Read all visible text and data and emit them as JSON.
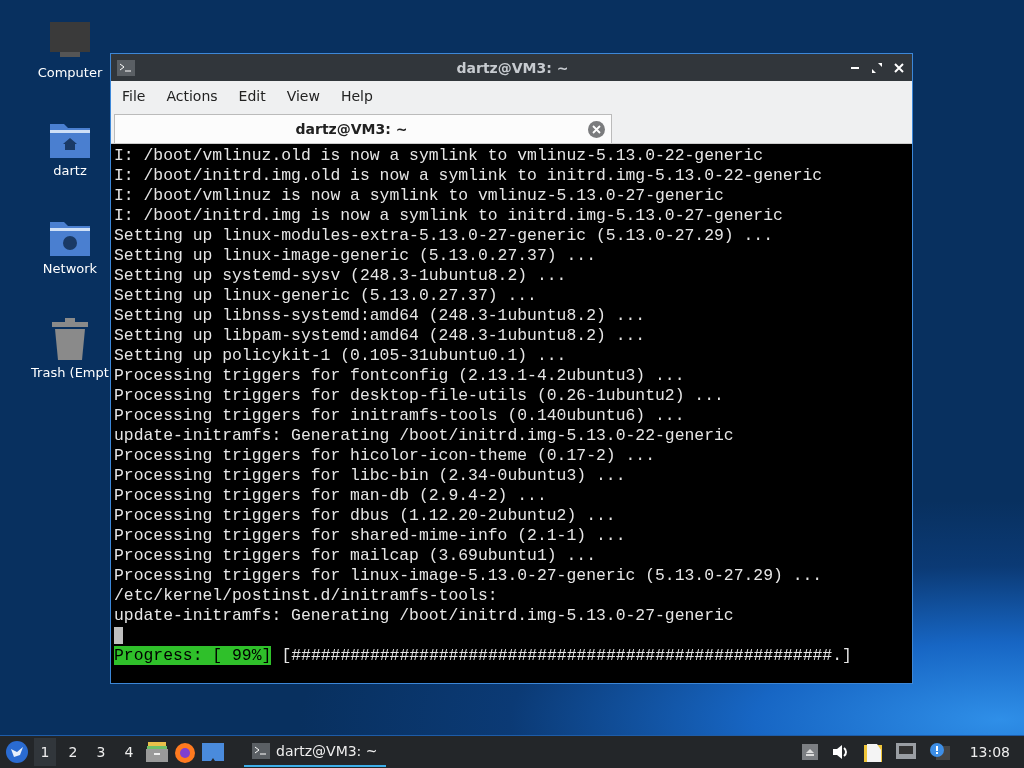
{
  "desktop_icons": [
    {
      "label": "Computer",
      "kind": "computer"
    },
    {
      "label": "dartz",
      "kind": "home"
    },
    {
      "label": "Network",
      "kind": "network"
    },
    {
      "label": "Trash (Empt",
      "kind": "trash"
    }
  ],
  "window": {
    "title": "dartz@VM3: ~",
    "menu": [
      "File",
      "Actions",
      "Edit",
      "View",
      "Help"
    ],
    "tabs": [
      {
        "label": "dartz@VM3: ~",
        "selected": true
      }
    ],
    "terminal": {
      "lines": [
        {
          "kind": "text",
          "text": "I: /boot/vmlinuz.old is now a symlink to vmlinuz-5.13.0-22-generic"
        },
        {
          "kind": "text",
          "text": "I: /boot/initrd.img.old is now a symlink to initrd.img-5.13.0-22-generic"
        },
        {
          "kind": "text",
          "text": "I: /boot/vmlinuz is now a symlink to vmlinuz-5.13.0-27-generic"
        },
        {
          "kind": "text",
          "text": "I: /boot/initrd.img is now a symlink to initrd.img-5.13.0-27-generic"
        },
        {
          "kind": "text",
          "text": "Setting up linux-modules-extra-5.13.0-27-generic (5.13.0-27.29) ..."
        },
        {
          "kind": "text",
          "text": "Setting up linux-image-generic (5.13.0.27.37) ..."
        },
        {
          "kind": "text",
          "text": "Setting up systemd-sysv (248.3-1ubuntu8.2) ..."
        },
        {
          "kind": "text",
          "text": "Setting up linux-generic (5.13.0.27.37) ..."
        },
        {
          "kind": "text",
          "text": "Setting up libnss-systemd:amd64 (248.3-1ubuntu8.2) ..."
        },
        {
          "kind": "text",
          "text": "Setting up libpam-systemd:amd64 (248.3-1ubuntu8.2) ..."
        },
        {
          "kind": "text",
          "text": "Setting up policykit-1 (0.105-31ubuntu0.1) ..."
        },
        {
          "kind": "text",
          "text": "Processing triggers for fontconfig (2.13.1-4.2ubuntu3) ..."
        },
        {
          "kind": "text",
          "text": "Processing triggers for desktop-file-utils (0.26-1ubuntu2) ..."
        },
        {
          "kind": "text",
          "text": "Processing triggers for initramfs-tools (0.140ubuntu6) ..."
        },
        {
          "kind": "text",
          "text": "update-initramfs: Generating /boot/initrd.img-5.13.0-22-generic"
        },
        {
          "kind": "text",
          "text": "Processing triggers for hicolor-icon-theme (0.17-2) ..."
        },
        {
          "kind": "text",
          "text": "Processing triggers for libc-bin (2.34-0ubuntu3) ..."
        },
        {
          "kind": "text",
          "text": "Processing triggers for man-db (2.9.4-2) ..."
        },
        {
          "kind": "text",
          "text": "Processing triggers for dbus (1.12.20-2ubuntu2) ..."
        },
        {
          "kind": "text",
          "text": "Processing triggers for shared-mime-info (2.1-1) ..."
        },
        {
          "kind": "text",
          "text": "Processing triggers for mailcap (3.69ubuntu1) ..."
        },
        {
          "kind": "text",
          "text": "Processing triggers for linux-image-5.13.0-27-generic (5.13.0-27.29) ..."
        },
        {
          "kind": "text",
          "text": "/etc/kernel/postinst.d/initramfs-tools:"
        },
        {
          "kind": "text",
          "text": "update-initramfs: Generating /boot/initrd.img-5.13.0-27-generic"
        },
        {
          "kind": "cursor"
        },
        {
          "kind": "progress",
          "label": "Progress: [ 99%]",
          "bar": "[#######################################################.]"
        }
      ]
    }
  },
  "taskbar": {
    "workspaces": [
      {
        "label": "1",
        "selected": true
      },
      {
        "label": "2",
        "selected": false
      },
      {
        "label": "3",
        "selected": false
      },
      {
        "label": "4",
        "selected": false
      }
    ],
    "tasks": [
      {
        "label": "dartz@VM3: ~",
        "selected": true
      }
    ],
    "clock": "13:08"
  }
}
